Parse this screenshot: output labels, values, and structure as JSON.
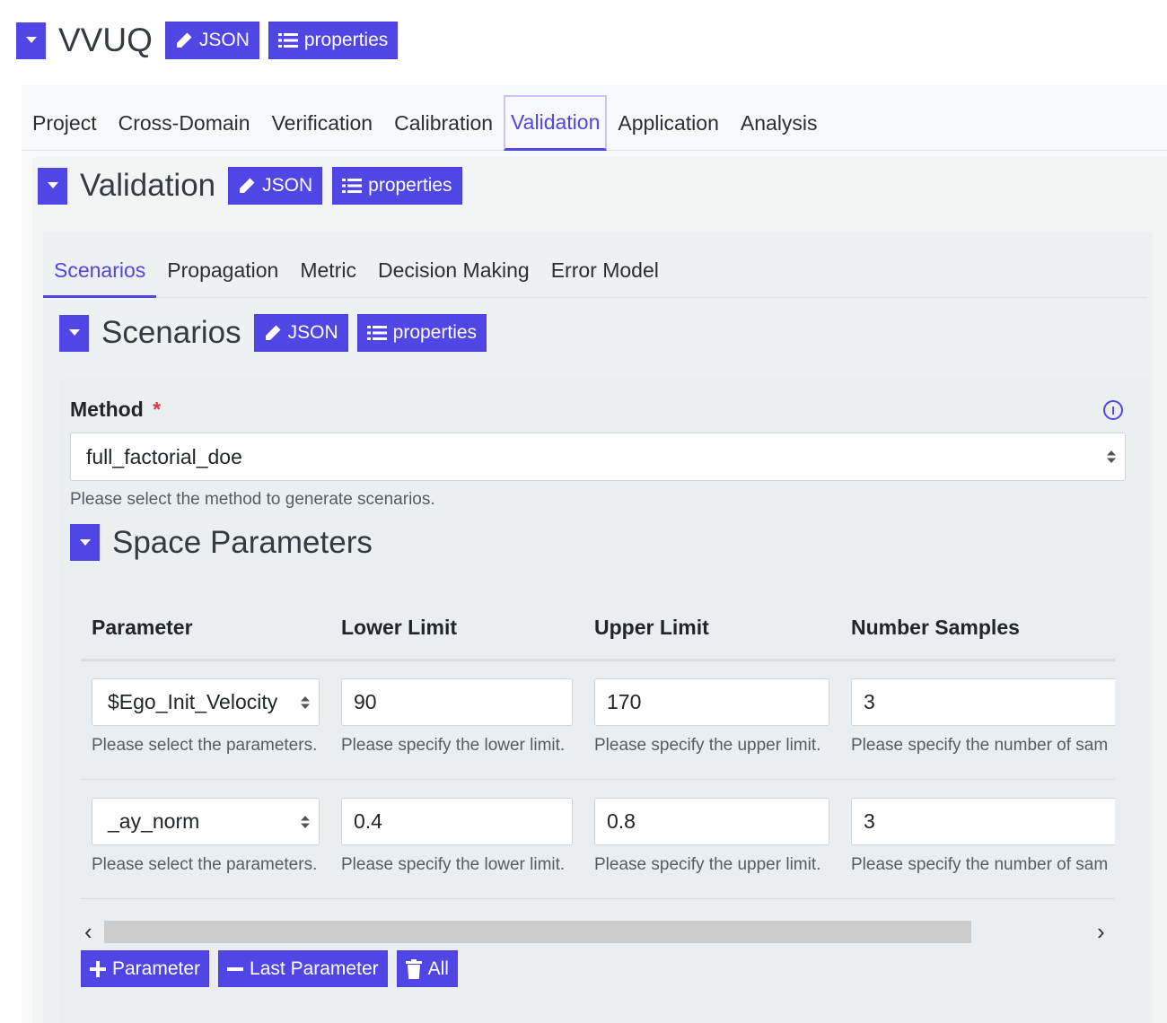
{
  "top": {
    "title": "VVUQ",
    "json_label": "JSON",
    "properties_label": "properties"
  },
  "main_tabs": [
    {
      "label": "Project",
      "active": false
    },
    {
      "label": "Cross-Domain",
      "active": false
    },
    {
      "label": "Verification",
      "active": false
    },
    {
      "label": "Calibration",
      "active": false
    },
    {
      "label": "Validation",
      "active": true
    },
    {
      "label": "Application",
      "active": false
    },
    {
      "label": "Analysis",
      "active": false
    }
  ],
  "validation": {
    "title": "Validation",
    "json_label": "JSON",
    "properties_label": "properties"
  },
  "sub_tabs": [
    {
      "label": "Scenarios",
      "active": true
    },
    {
      "label": "Propagation",
      "active": false
    },
    {
      "label": "Metric",
      "active": false
    },
    {
      "label": "Decision Making",
      "active": false
    },
    {
      "label": "Error Model",
      "active": false
    }
  ],
  "scenarios": {
    "title": "Scenarios",
    "json_label": "JSON",
    "properties_label": "properties",
    "method": {
      "label": "Method",
      "required_mark": "*",
      "value": "full_factorial_doe",
      "help": "Please select the method to generate scenarios.",
      "info_icon": "info-icon"
    },
    "space_parameters": {
      "title": "Space Parameters",
      "columns": [
        "Parameter",
        "Lower Limit",
        "Upper Limit",
        "Number Samples"
      ],
      "rows": [
        {
          "parameter": "$Ego_Init_Velocity",
          "lower": "90",
          "upper": "170",
          "samples": "3",
          "help_parameter": "Please select the parameters.",
          "help_lower": "Please specify the lower limit.",
          "help_upper": "Please specify the upper limit.",
          "help_samples": "Please specify the number of sam"
        },
        {
          "parameter": "_ay_norm",
          "lower": "0.4",
          "upper": "0.8",
          "samples": "3",
          "help_parameter": "Please select the parameters.",
          "help_lower": "Please specify the lower limit.",
          "help_upper": "Please specify the upper limit.",
          "help_samples": "Please specify the number of sam"
        }
      ],
      "scroll_left": "‹",
      "scroll_right": "›",
      "add_label": "Parameter",
      "remove_label": "Last Parameter",
      "clear_label": "All"
    }
  },
  "colors": {
    "accent": "#5046e5",
    "required": "#dc3545"
  }
}
